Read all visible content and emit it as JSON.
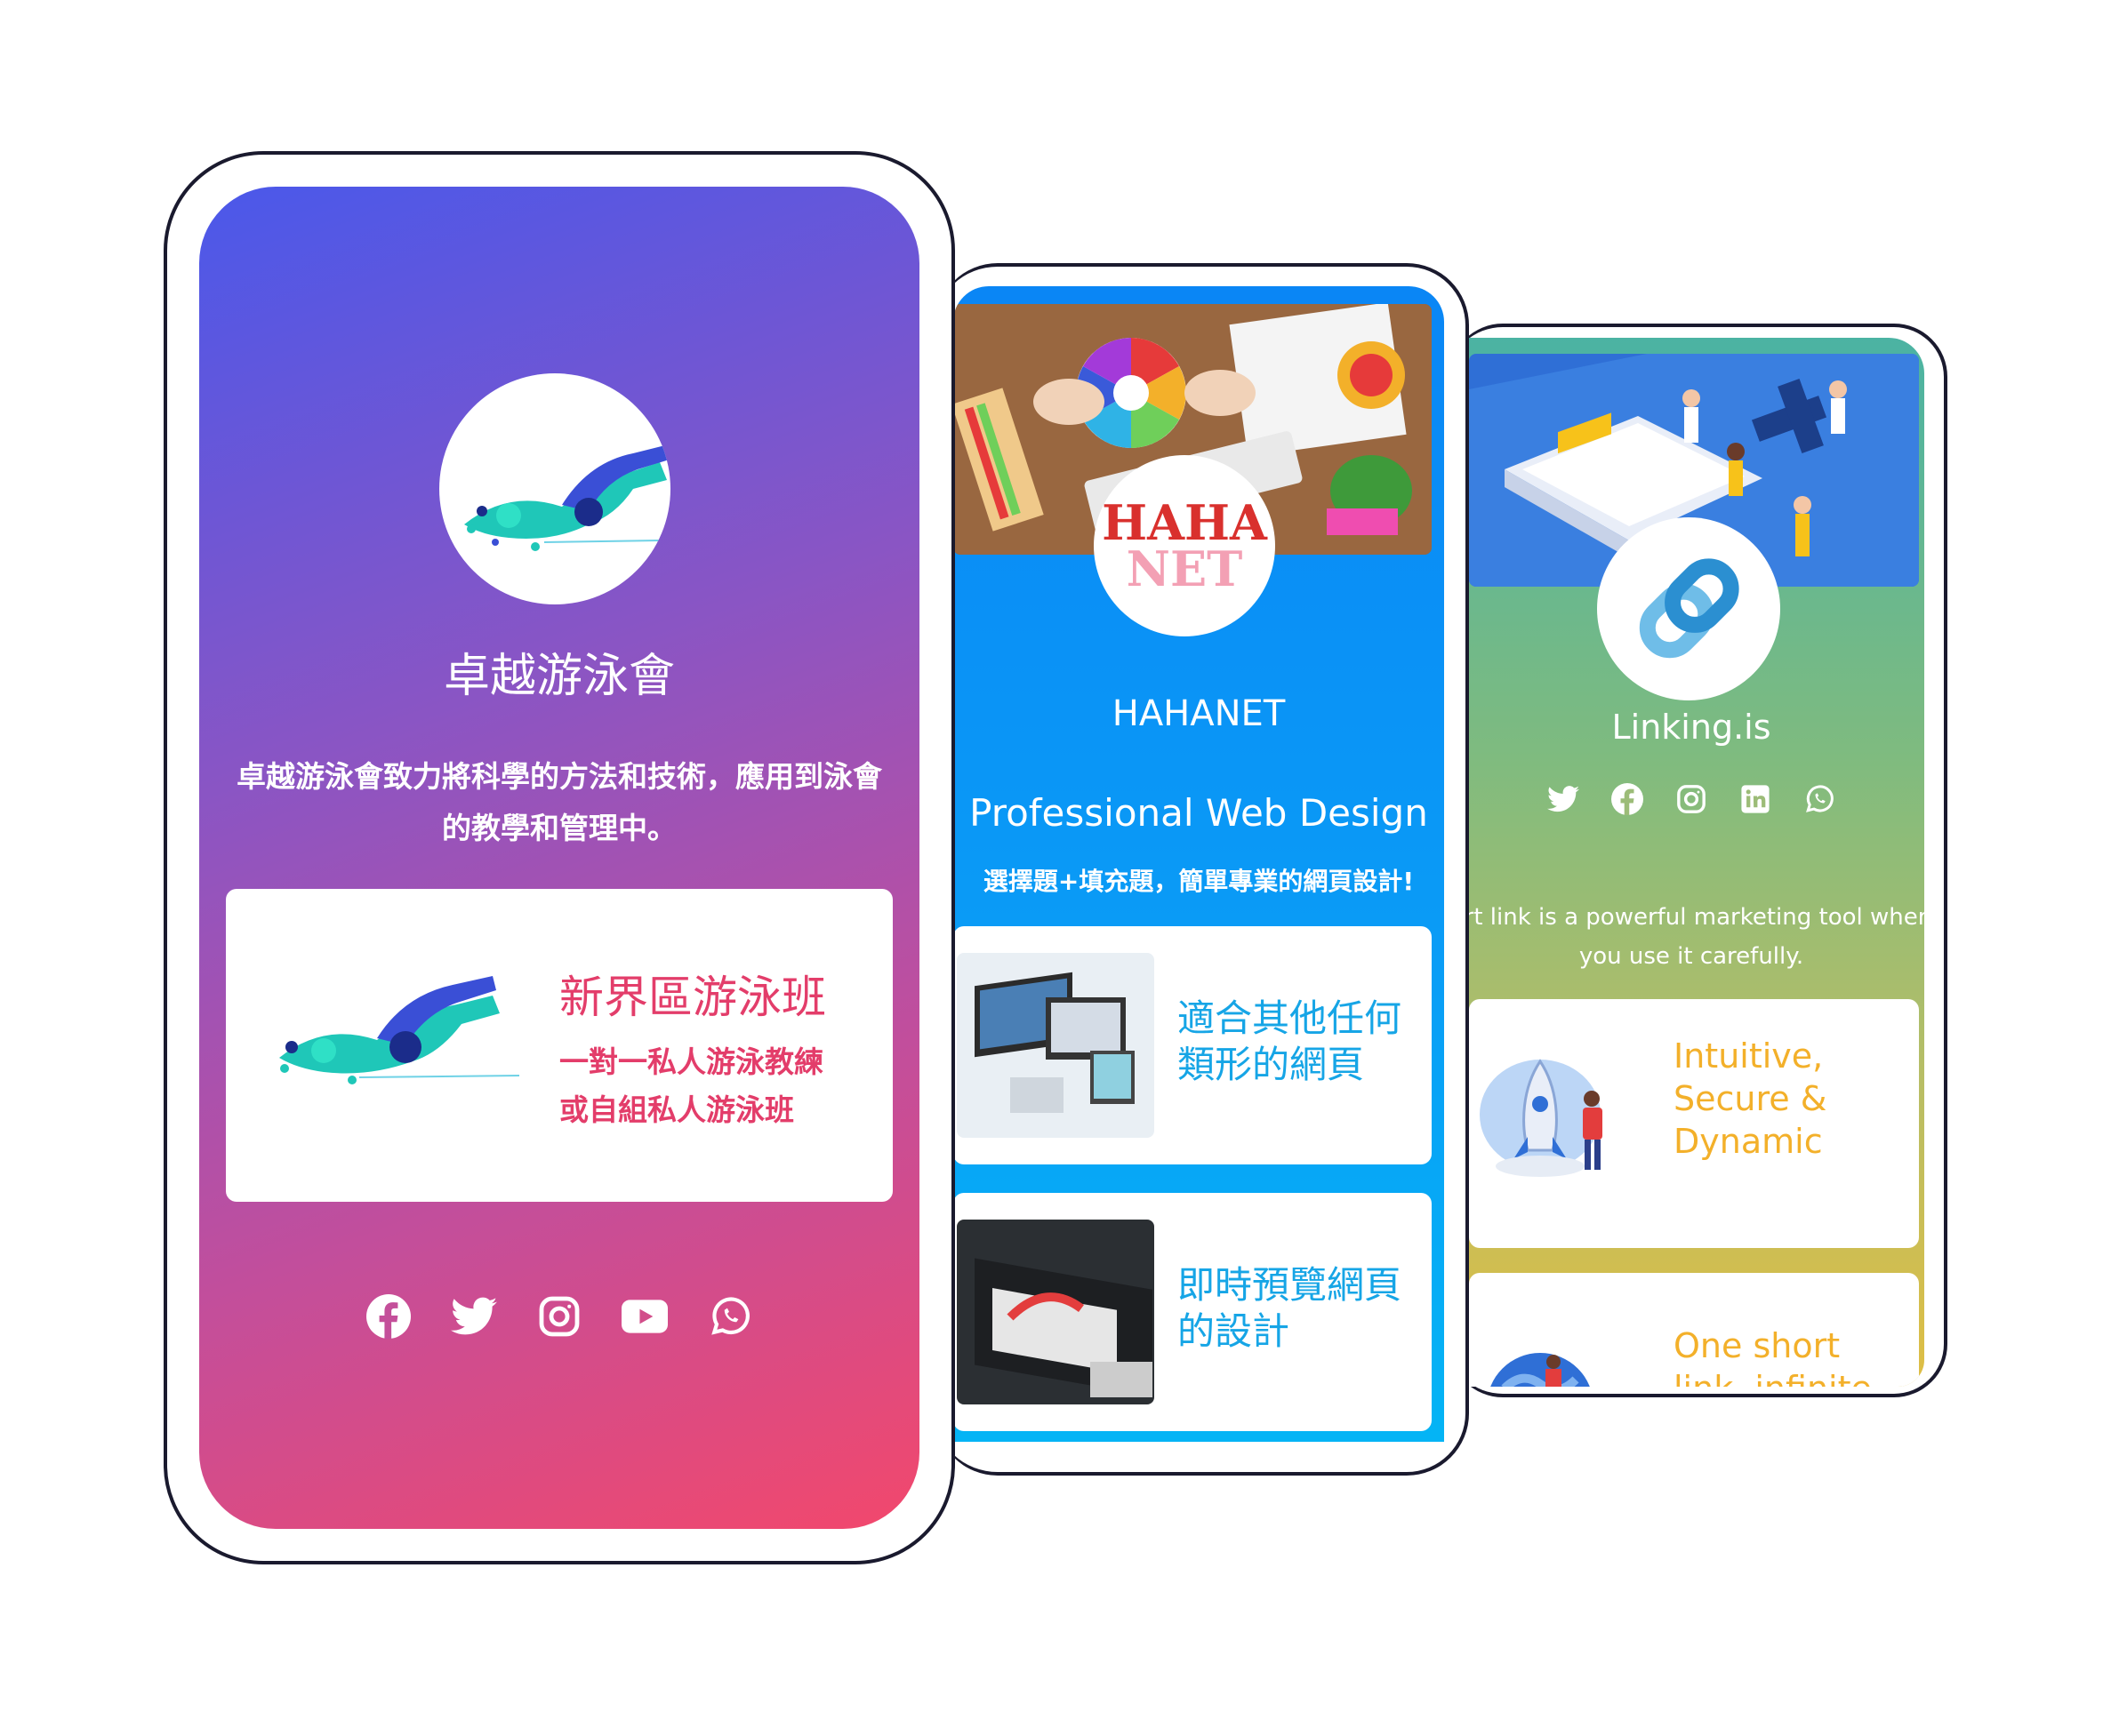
{
  "swim_club": {
    "title": "卓越游泳會",
    "description": "卓越游泳會致力將科學的方法和技術，應用到泳會的教學和管理中。",
    "card": {
      "title": "新界區游泳班",
      "line1": "一對一私人游泳教練",
      "line2": "或自組私人游泳班"
    },
    "social": [
      "facebook-icon",
      "twitter-icon",
      "instagram-icon",
      "youtube-icon",
      "whatsapp-icon"
    ]
  },
  "hahanet": {
    "logo_line1": "HAHA",
    "logo_line2": "NET",
    "name": "HAHANET",
    "headline": "Professional Web Design",
    "subtitle": "選擇題+填充題，簡單專業的網頁設計!",
    "cards": [
      {
        "title": "適合其他任何類形的網頁"
      },
      {
        "title": "即時預覽網頁的設計"
      }
    ]
  },
  "linking": {
    "name": "Linking.is",
    "social": [
      "twitter-icon",
      "facebook-icon",
      "instagram-icon",
      "linkedin-icon",
      "whatsapp-icon"
    ],
    "description_line1": "ort link is a powerful marketing tool when",
    "description_line2": "you use it carefully.",
    "cards": [
      {
        "title": [
          "Intuitive,",
          "Secure &",
          "Dynamic"
        ]
      },
      {
        "title": [
          "One short",
          "link, infinite"
        ]
      }
    ]
  },
  "colors": {
    "swim_gradient": [
      "#4a58ea",
      "#f2486c"
    ],
    "swim_accent": "#e33d6a",
    "hahanet_blue": "#0a86f5",
    "hahanet_card_text": "#16a5e6",
    "linking_gradient": [
      "#4bb3a3",
      "#dfbe44"
    ],
    "linking_card_text": "#f3b02a"
  }
}
